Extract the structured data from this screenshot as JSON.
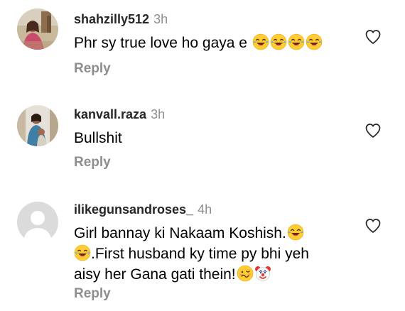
{
  "comments": [
    {
      "username": "shahzilly512",
      "time": "3h",
      "text": "Phr sy true love ho gaya e",
      "emojis": [
        "joy-emoji",
        "joy-emoji",
        "joy-emoji",
        "joy-emoji"
      ],
      "reply_label": "Reply",
      "avatar": "photo-avatar-woman"
    },
    {
      "username": "kanvall.raza",
      "time": "3h",
      "text": "Bullshit",
      "reply_label": "Reply",
      "avatar": "photo-avatar-woman-child"
    },
    {
      "username": "ilikegunsandroses_",
      "time": "4h",
      "text_line1": "Girl bannay ki Nakaam Koshish.",
      "text_line2": ".First husband ky time py bhi yeh",
      "text_line3": "aisy her Gana gati thein!",
      "reply_label": "Reply",
      "avatar": "default-avatar"
    }
  ],
  "icons": {
    "like": "heart-outline-icon",
    "emoji_joy": "face-with-tears-of-joy",
    "emoji_woozy": "woozy-face",
    "emoji_clown": "clown-face"
  },
  "colors": {
    "username": "#262626",
    "secondary": "#8e8e8e",
    "text": "#000000",
    "default_avatar": "#dbdbdb"
  }
}
